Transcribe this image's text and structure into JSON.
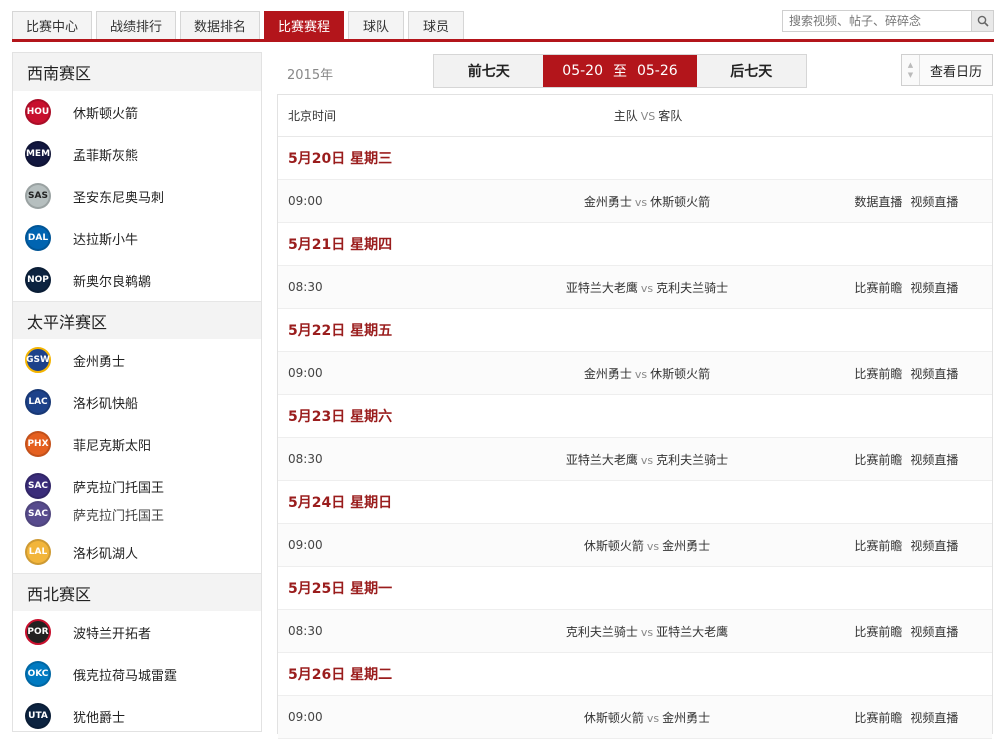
{
  "nav": {
    "tabs": [
      {
        "label": "比赛中心",
        "active": false
      },
      {
        "label": "战绩排行",
        "active": false
      },
      {
        "label": "数据排名",
        "active": false
      },
      {
        "label": "比赛赛程",
        "active": true
      },
      {
        "label": "球队",
        "active": false
      },
      {
        "label": "球员",
        "active": false
      }
    ],
    "search_placeholder": "搜索视频、帖子、碎碎念",
    "accent_color": "#b3151b"
  },
  "sidebar": {
    "conferences": [
      {
        "name": "西南赛区",
        "teams": [
          {
            "abbr": "HOU",
            "name": "休斯顿火箭",
            "color": "#c8102e"
          },
          {
            "abbr": "MEM",
            "name": "孟菲斯灰熊",
            "color": "#12173f"
          },
          {
            "abbr": "SAS",
            "name": "圣安东尼奥马刺",
            "color": "#b6bfbf"
          },
          {
            "abbr": "DAL",
            "name": "达拉斯小牛",
            "color": "#0064b1"
          },
          {
            "abbr": "NOP",
            "name": "新奥尔良鹈鹕",
            "color": "#0c2340"
          }
        ]
      },
      {
        "name": "太平洋赛区",
        "teams": [
          {
            "abbr": "GSW",
            "name": "金州勇士",
            "color": "#1d428a"
          },
          {
            "abbr": "LAC",
            "name": "洛杉矶快船",
            "color": "#1d428a"
          },
          {
            "abbr": "PHX",
            "name": "菲尼克斯太阳",
            "color": "#e56020"
          },
          {
            "abbr": "SAC",
            "name": "萨克拉门托国王",
            "color": "#3a2c7a"
          },
          {
            "abbr": "SAC",
            "name": "萨克拉门托国王",
            "color": "#3a2c7a"
          },
          {
            "abbr": "LAL",
            "name": "洛杉矶湖人",
            "color": "#f2b53b"
          }
        ]
      },
      {
        "name": "西北赛区",
        "teams": [
          {
            "abbr": "POR",
            "name": "波特兰开拓者",
            "color": "#222222"
          },
          {
            "abbr": "OKC",
            "name": "俄克拉荷马城雷霆",
            "color": "#007ac1"
          },
          {
            "abbr": "UTA",
            "name": "犹他爵士",
            "color": "#0c2340"
          }
        ]
      }
    ]
  },
  "main": {
    "season": "2015年",
    "prev_week": "前七天",
    "next_week": "后七天",
    "range_start": "05-20",
    "range_sep": "至",
    "range_end": "05-26",
    "calendar_label": "查看日历",
    "header": {
      "time": "北京时间",
      "home": "主队",
      "vs": "VS",
      "away": "客队"
    },
    "days": [
      {
        "date": "5月20日 星期三",
        "games": [
          {
            "time": "09:00",
            "home": "金州勇士",
            "away": "休斯顿火箭",
            "action1": "数据直播",
            "action2": "视频直播"
          }
        ]
      },
      {
        "date": "5月21日 星期四",
        "games": [
          {
            "time": "08:30",
            "home": "亚特兰大老鹰",
            "away": "克利夫兰骑士",
            "action1": "比赛前瞻",
            "action2": "视频直播"
          }
        ]
      },
      {
        "date": "5月22日 星期五",
        "games": [
          {
            "time": "09:00",
            "home": "金州勇士",
            "away": "休斯顿火箭",
            "action1": "比赛前瞻",
            "action2": "视频直播"
          }
        ]
      },
      {
        "date": "5月23日 星期六",
        "games": [
          {
            "time": "08:30",
            "home": "亚特兰大老鹰",
            "away": "克利夫兰骑士",
            "action1": "比赛前瞻",
            "action2": "视频直播"
          }
        ]
      },
      {
        "date": "5月24日 星期日",
        "games": [
          {
            "time": "09:00",
            "home": "休斯顿火箭",
            "away": "金州勇士",
            "action1": "比赛前瞻",
            "action2": "视频直播"
          }
        ]
      },
      {
        "date": "5月25日 星期一",
        "games": [
          {
            "time": "08:30",
            "home": "克利夫兰骑士",
            "away": "亚特兰大老鹰",
            "action1": "比赛前瞻",
            "action2": "视频直播"
          }
        ]
      },
      {
        "date": "5月26日 星期二",
        "games": [
          {
            "time": "09:00",
            "home": "休斯顿火箭",
            "away": "金州勇士",
            "action1": "比赛前瞻",
            "action2": "视频直播"
          }
        ]
      }
    ],
    "vs_text": "vs"
  }
}
